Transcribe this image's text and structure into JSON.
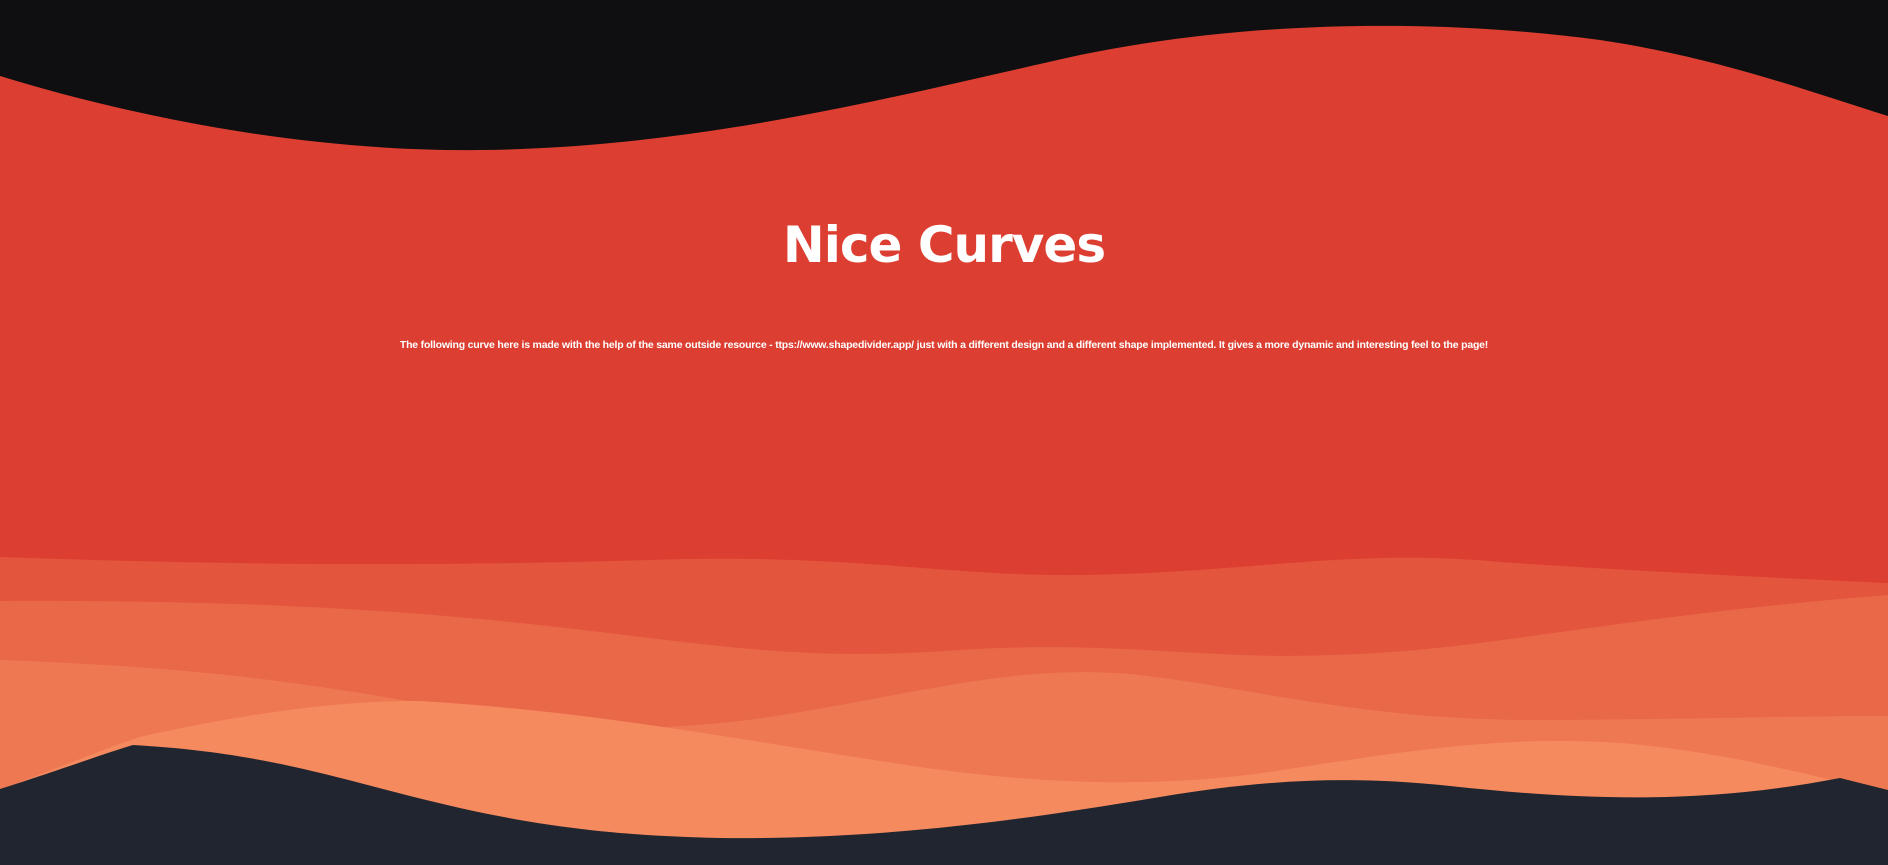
{
  "hero": {
    "title": "Nice Curves",
    "description": "The following curve here is made with the help of the same outside resource - ttps://www.shapedivider.app/ just with a different design and a different shape implemented. It gives a more dynamic and interesting feel to the page!"
  },
  "colors": {
    "top_background": "#0f0f12",
    "hero_red": "#dc3f31",
    "wave_layer_1": "#e4553d",
    "wave_layer_2": "#e96848",
    "wave_layer_3": "#ee7852",
    "wave_layer_4": "#f68a5f",
    "bottom_background": "#21252f",
    "text": "#ffffff"
  }
}
